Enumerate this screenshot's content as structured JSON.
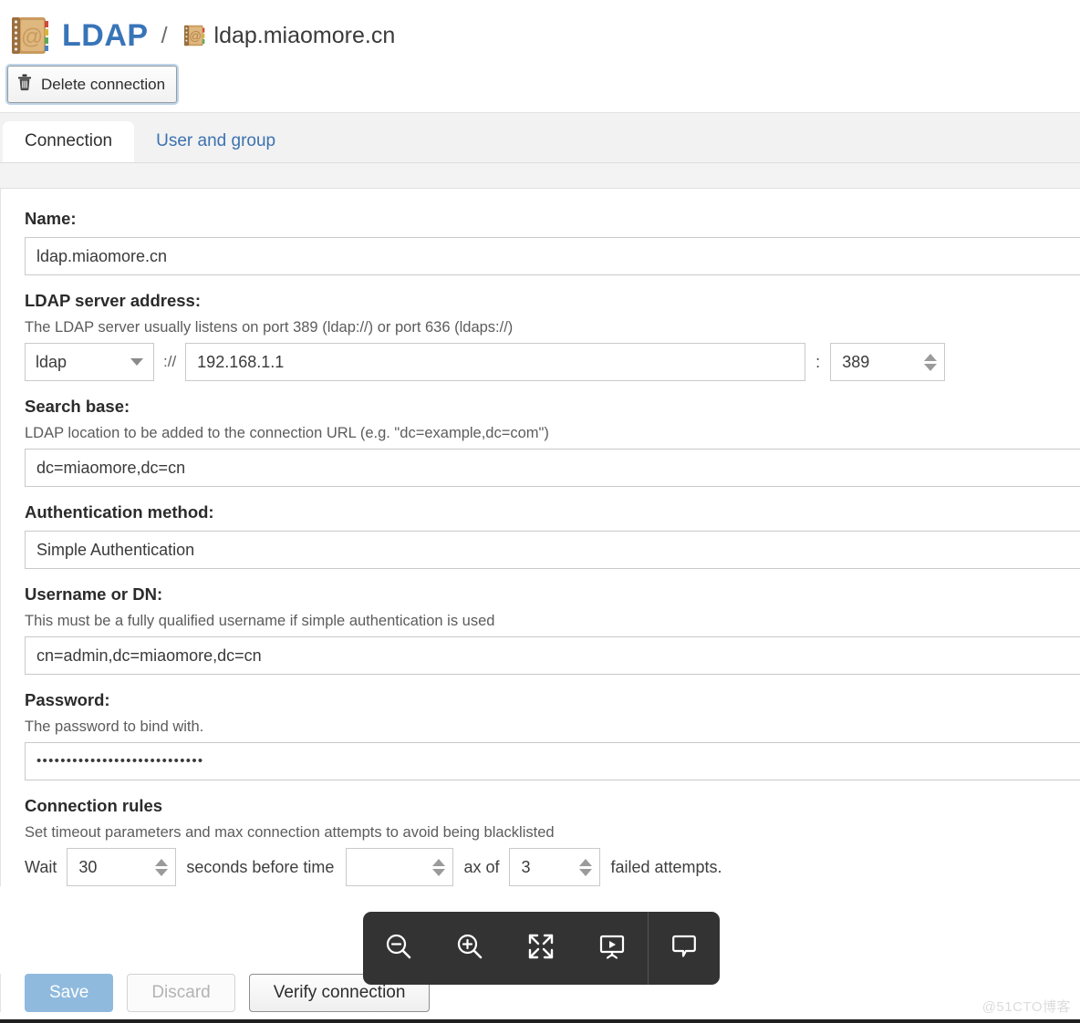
{
  "header": {
    "app_icon": "address-book-icon",
    "app_title": "LDAP",
    "separator": "/",
    "crumb_icon": "address-book-icon",
    "crumb_name": "ldap.miaomore.cn"
  },
  "toolbar": {
    "delete_icon": "trash-icon",
    "delete_label": "Delete connection"
  },
  "tabs": [
    {
      "label": "Connection",
      "active": true
    },
    {
      "label": "User and group",
      "active": false
    }
  ],
  "form": {
    "name": {
      "label": "Name:",
      "value": "ldap.miaomore.cn"
    },
    "server_address": {
      "label": "LDAP server address:",
      "hint": "The LDAP server usually listens on port 389 (ldap://) or port 636 (ldaps://)",
      "protocol": "ldap",
      "protocol_sep": "://",
      "host": "192.168.1.1",
      "colon": ":",
      "port": "389"
    },
    "search_base": {
      "label": "Search base:",
      "hint": "LDAP location to be added to the connection URL (e.g. \"dc=example,dc=com\")",
      "value": "dc=miaomore,dc=cn"
    },
    "auth_method": {
      "label": "Authentication method:",
      "value": "Simple Authentication"
    },
    "username": {
      "label": "Username or DN:",
      "hint": "This must be a fully qualified username if simple authentication is used",
      "value": "cn=admin,dc=miaomore,dc=cn"
    },
    "password": {
      "label": "Password:",
      "hint": "The password to bind with.",
      "value": "••••••••••••••••••••••••••••"
    },
    "connection_rules": {
      "label": "Connection rules",
      "hint": "Set timeout parameters and max connection attempts to avoid being blacklisted",
      "wait_prefix": "Wait",
      "wait_value": "30",
      "wait_middle": "seconds before time",
      "attempts_prefix": "ax of",
      "attempts_value": "3",
      "attempts_suffix": "failed attempts."
    }
  },
  "buttons": {
    "save": "Save",
    "discard": "Discard",
    "verify": "Verify connection"
  },
  "float_toolbar": {
    "items": [
      {
        "icon": "zoom-out-icon"
      },
      {
        "icon": "zoom-in-icon"
      },
      {
        "icon": "fullscreen-icon"
      },
      {
        "icon": "presentation-icon"
      },
      {
        "icon": "comment-icon"
      }
    ]
  },
  "watermark": "@51CTO博客",
  "colors": {
    "brand_blue": "#3874b8",
    "link_blue": "#3c72b0",
    "save_blue": "#8fbadd",
    "toolbar_dark": "#333333"
  }
}
